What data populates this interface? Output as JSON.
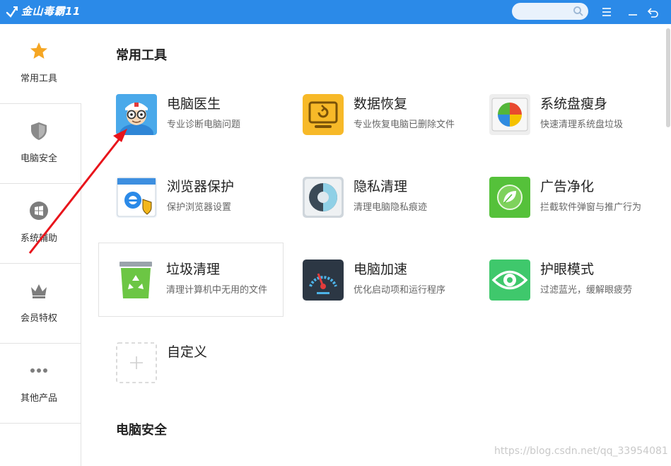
{
  "app": {
    "title": "金山毒霸11"
  },
  "search": {
    "placeholder": ""
  },
  "sidebar": {
    "items": [
      {
        "label": "常用工具",
        "icon": "star-icon"
      },
      {
        "label": "电脑安全",
        "icon": "shield-icon"
      },
      {
        "label": "系统辅助",
        "icon": "windows-icon"
      },
      {
        "label": "会员特权",
        "icon": "crown-icon"
      },
      {
        "label": "其他产品",
        "icon": "more-dots-icon"
      }
    ]
  },
  "main": {
    "sections": [
      {
        "title": "常用工具"
      },
      {
        "title": "电脑安全"
      }
    ],
    "tools": [
      {
        "name": "电脑医生",
        "desc": "专业诊断电脑问题",
        "icon": "doctor-icon"
      },
      {
        "name": "数据恢复",
        "desc": "专业恢复电脑已删除文件",
        "icon": "data-recovery-icon"
      },
      {
        "name": "系统盘瘦身",
        "desc": "快速清理系统盘垃圾",
        "icon": "disk-slim-icon"
      },
      {
        "name": "浏览器保护",
        "desc": "保护浏览器设置",
        "icon": "browser-protect-icon"
      },
      {
        "name": "隐私清理",
        "desc": "清理电脑隐私痕迹",
        "icon": "privacy-clean-icon"
      },
      {
        "name": "广告净化",
        "desc": "拦截软件弹窗与推广行为",
        "icon": "ad-block-icon"
      },
      {
        "name": "垃圾清理",
        "desc": "清理计算机中无用的文件",
        "icon": "trash-clean-icon"
      },
      {
        "name": "电脑加速",
        "desc": "优化启动项和运行程序",
        "icon": "speedup-icon"
      },
      {
        "name": "护眼模式",
        "desc": "过滤蓝光，缓解眼疲劳",
        "icon": "eye-care-icon"
      },
      {
        "name": "自定义",
        "desc": "",
        "icon": "add-custom-icon"
      }
    ]
  },
  "watermark": "https://blog.csdn.net/qq_33954081",
  "colors": {
    "titlebar": "#2b8ae8",
    "star": "#f5a623",
    "arrow": "#e8141b"
  }
}
